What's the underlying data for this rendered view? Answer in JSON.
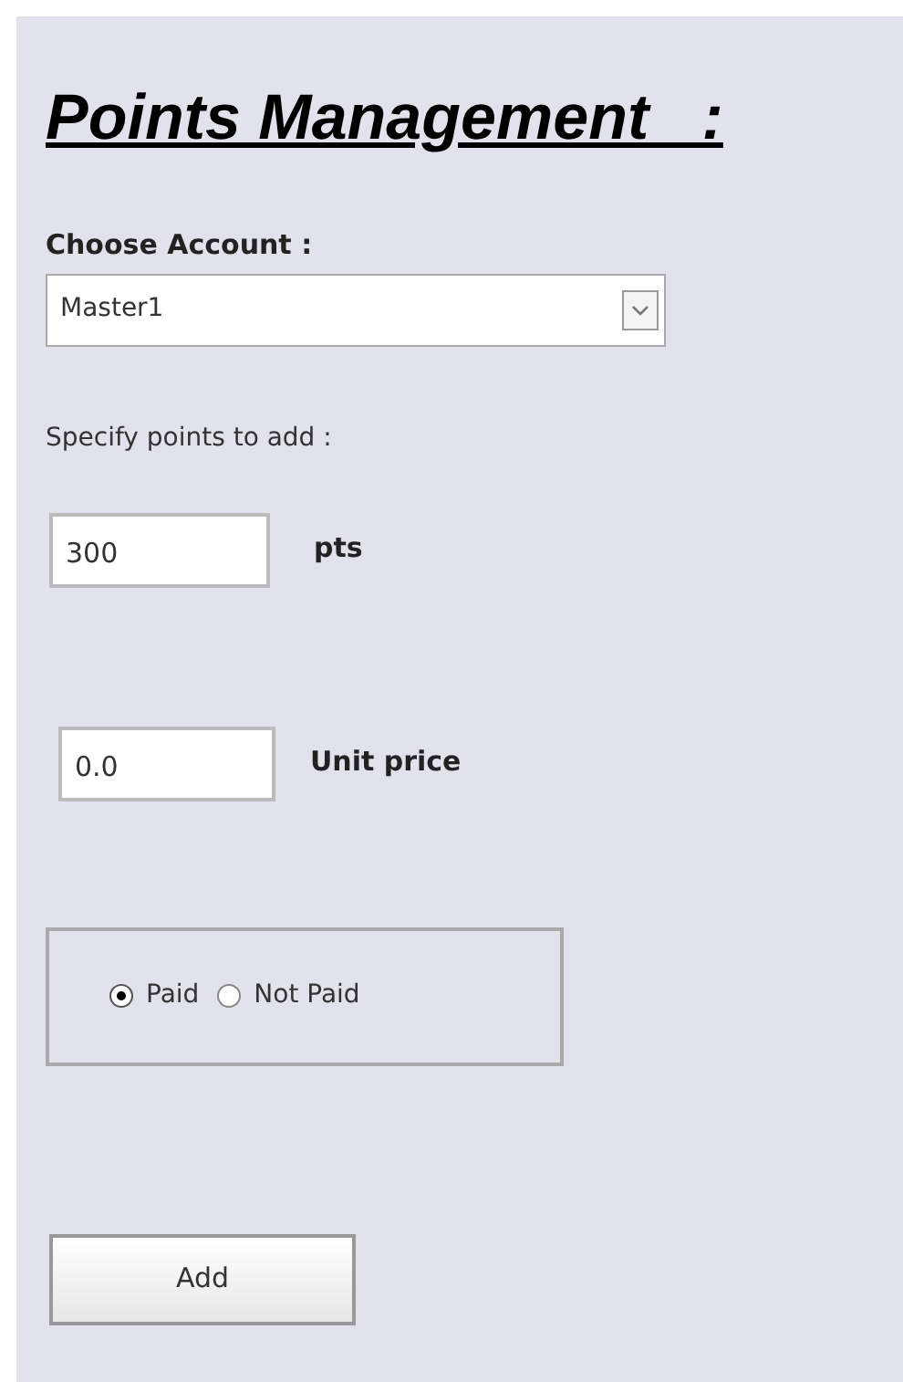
{
  "title": "Points Management   :",
  "account": {
    "label": "Choose Account :",
    "value": "Master1"
  },
  "points": {
    "label": "Specify points to add :",
    "value": "300",
    "unit": "pts"
  },
  "price": {
    "value": "0.0",
    "label": "Unit price"
  },
  "payment": [
    {
      "label": "Paid",
      "selected": true
    },
    {
      "label": "Not Paid",
      "selected": false
    }
  ],
  "button": "Add"
}
